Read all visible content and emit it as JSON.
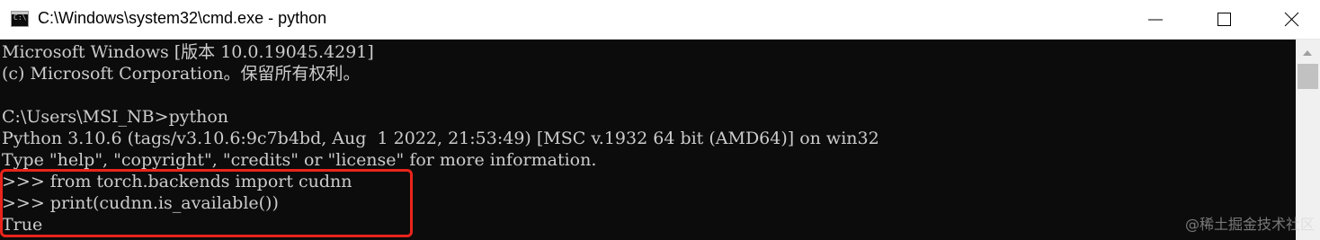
{
  "window": {
    "title": "C:\\Windows\\system32\\cmd.exe - python",
    "icon": "cmd-icon",
    "icon_glyph": "C:\\",
    "controls": [
      "minimize-icon",
      "maximize-icon",
      "close-icon"
    ]
  },
  "console": {
    "background": "#0c0c0c",
    "foreground": "#cccccc",
    "lines": [
      "Microsoft Windows [版本 10.0.19045.4291]",
      "(c) Microsoft Corporation。保留所有权利。",
      "",
      "C:\\Users\\MSI_NB>python",
      "Python 3.10.6 (tags/v3.10.6:9c7b4bd, Aug  1 2022, 21:53:49) [MSC v.1932 64 bit (AMD64)] on win32",
      "Type \"help\", \"copyright\", \"credits\" or \"license\" for more information.",
      ">>> from torch.backends import cudnn",
      ">>> print(cudnn.is_available())",
      "True"
    ]
  },
  "annotation": {
    "highlight_color": "#e8241b"
  },
  "watermark": "@稀土掘金技术社区"
}
